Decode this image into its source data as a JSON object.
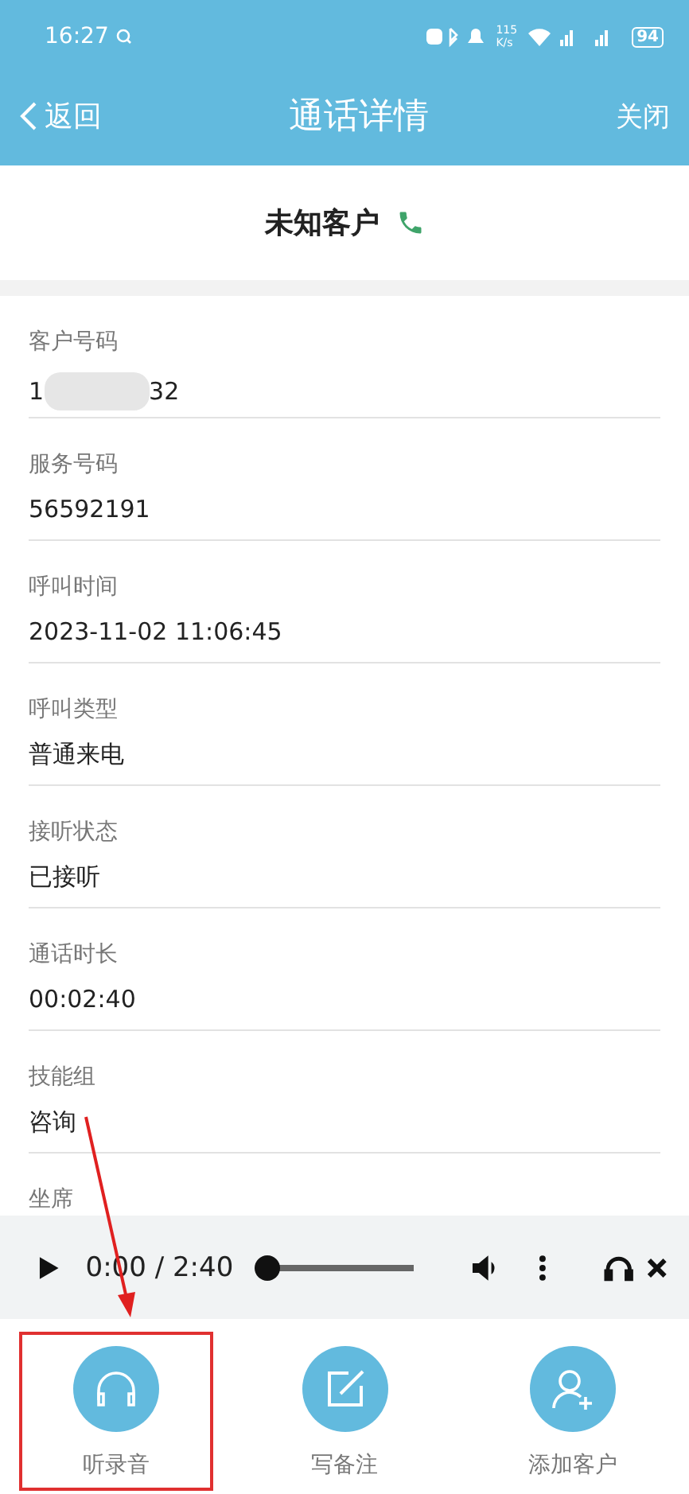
{
  "status_bar": {
    "time": "16:27",
    "speed": "115",
    "speed_unit": "K/s",
    "battery": "94"
  },
  "header": {
    "back": "返回",
    "title": "通话详情",
    "close": "关闭"
  },
  "customer": {
    "name": "未知客户"
  },
  "fields": [
    {
      "label": "客户号码",
      "value": "1",
      "value_tail": "32",
      "masked": true
    },
    {
      "label": "服务号码",
      "value": "56592191",
      "masked": false
    },
    {
      "label": "呼叫时间",
      "value": "2023-11-02 11:06:45",
      "masked": false
    },
    {
      "label": "呼叫类型",
      "value": "普通来电",
      "masked": false
    },
    {
      "label": "接听状态",
      "value": "已接听",
      "masked": false
    },
    {
      "label": "通话时长",
      "value": "00:02:40",
      "masked": false
    },
    {
      "label": "技能组",
      "value": "咨询",
      "masked": false
    },
    {
      "label": "坐席",
      "masked": false
    }
  ],
  "player": {
    "time": "0:00 / 2:40",
    "level": 0
  },
  "actions": [
    {
      "kind": "headphones",
      "label": "听录音",
      "highlighted": true
    },
    {
      "kind": "note",
      "label": "写备注",
      "highlighted": false
    },
    {
      "kind": "add-user",
      "label": "添加客户",
      "highlighted": false
    }
  ]
}
